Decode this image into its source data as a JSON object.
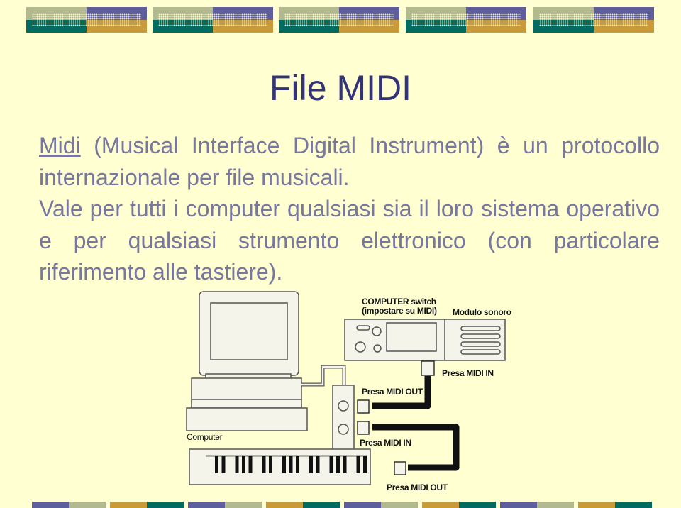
{
  "colors": {
    "background": "#FFFFD2",
    "title": "#333377",
    "body_text": "#7777A0",
    "sage": "#B3B98F",
    "purple": "#5E5E9C",
    "teal": "#006B5E",
    "gold": "#C99A3A"
  },
  "title": "File MIDI",
  "paragraphs": [
    {
      "link": "Midi",
      "text": " (Musical Interface Digital Instrument) è un protocollo internazionale per file musicali."
    },
    {
      "text": "Vale per tutti i computer qualsiasi sia il loro sistema operativo e per qualsiasi strumento elettronico (con particolare riferimento alle tastiere)."
    }
  ],
  "diagram": {
    "computer_switch": "COMPUTER switch",
    "switch_note": "(impostare su MIDI)",
    "sound_module": "Modulo sonoro",
    "module_midi_in": "Presa MIDI IN",
    "interface_midi_out": "Presa MIDI OUT",
    "interface_midi_in": "Presa MIDI IN",
    "keyboard_midi_out": "Presa MIDI OUT",
    "computer": "Computer"
  }
}
